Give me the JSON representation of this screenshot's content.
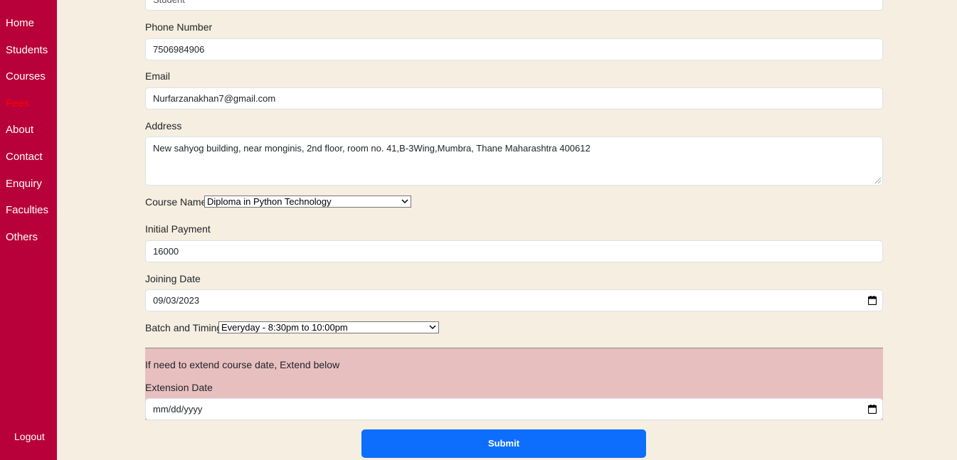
{
  "sidebar": {
    "items": [
      {
        "label": "Home"
      },
      {
        "label": "Students"
      },
      {
        "label": "Courses"
      },
      {
        "label": "Fees"
      },
      {
        "label": "About"
      },
      {
        "label": "Contact"
      },
      {
        "label": "Enquiry"
      },
      {
        "label": "Faculties"
      },
      {
        "label": "Others"
      }
    ],
    "active": "Fees",
    "logout_label": "Logout"
  },
  "form": {
    "top_field_value": "Student",
    "phone": {
      "label": "Phone Number",
      "value": "7506984906"
    },
    "email": {
      "label": "Email",
      "value": "Nurfarzanakhan7@gmail.com"
    },
    "address": {
      "label": "Address",
      "value": "New sahyog building, near monginis, 2nd floor, room no. 41,B-3Wing,Mumbra, Thane Maharashtra 400612"
    },
    "course": {
      "label": "Course Name",
      "selected": "Diploma in Python Technology"
    },
    "initial_payment": {
      "label": "Initial Payment",
      "value": "16000"
    },
    "joining_date": {
      "label": "Joining Date",
      "value": "09/03/2023"
    },
    "batch": {
      "label": "Batch and Timing",
      "selected": "Everyday - 8:30pm to 10:00pm"
    },
    "extension": {
      "note": "If need to extend course date, Extend below",
      "label": "Extension Date",
      "placeholder": "mm/dd/yyyy"
    },
    "submit_label": "Submit"
  },
  "colors": {
    "sidebar_bg": "#b8003a",
    "page_bg": "#f5eee1",
    "active_nav": "#ff0000",
    "extension_bg": "#e8bfbf",
    "submit_bg": "#0d6efd"
  }
}
